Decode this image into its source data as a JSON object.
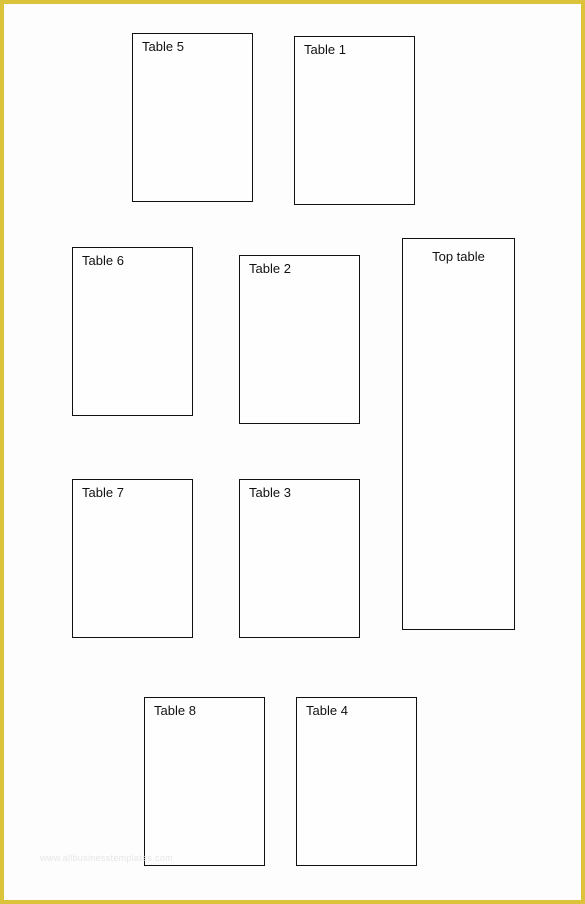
{
  "page": {
    "border_color": "#dcc33c",
    "watermark": "www.allbusinesstemplates.com"
  },
  "tables": {
    "table5": {
      "label": "Table 5"
    },
    "table1": {
      "label": "Table 1"
    },
    "table6": {
      "label": "Table 6"
    },
    "table2": {
      "label": "Table 2"
    },
    "top_table": {
      "label": "Top table"
    },
    "table7": {
      "label": "Table 7"
    },
    "table3": {
      "label": "Table 3"
    },
    "table8": {
      "label": "Table 8"
    },
    "table4": {
      "label": "Table 4"
    }
  }
}
